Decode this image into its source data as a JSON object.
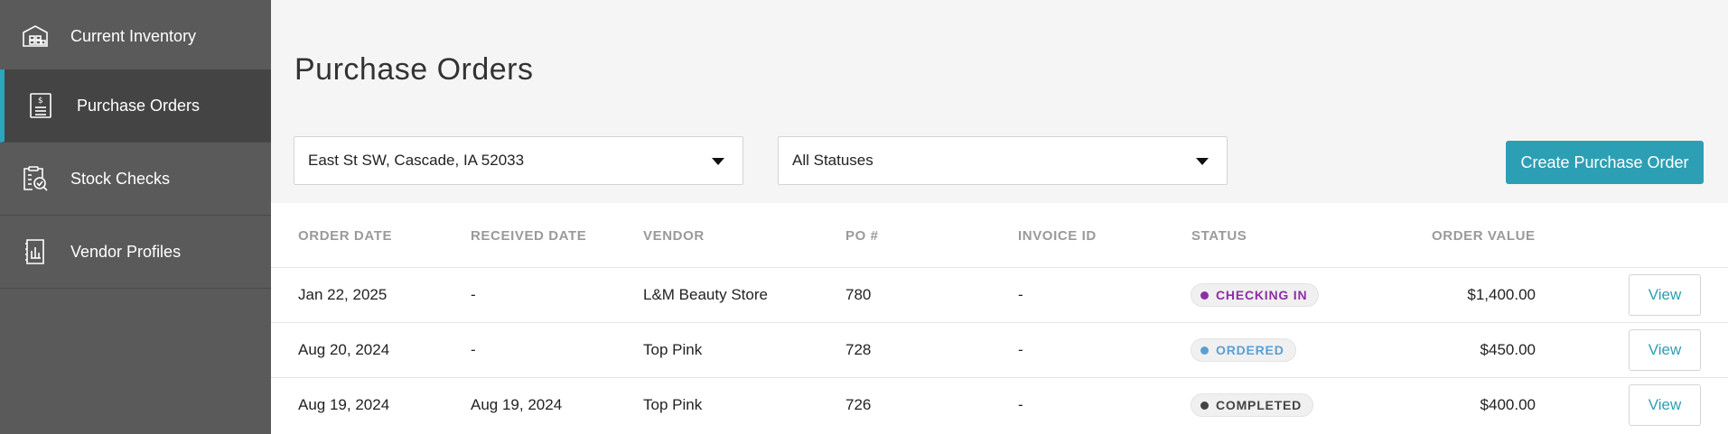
{
  "sidebar": {
    "items": [
      {
        "label": "Current Inventory",
        "icon": "warehouse-icon"
      },
      {
        "label": "Purchase Orders",
        "icon": "invoice-icon"
      },
      {
        "label": "Stock Checks",
        "icon": "clipboard-search-icon"
      },
      {
        "label": "Vendor Profiles",
        "icon": "vendor-document-icon"
      }
    ],
    "active_index": 1,
    "accent_color": "#2ba6bd"
  },
  "main": {
    "title": "Purchase Orders",
    "location_select": {
      "value": "East St SW, Cascade, IA 52033"
    },
    "status_select": {
      "value": "All Statuses"
    },
    "create_button": {
      "label": "Create Purchase Order",
      "color": "#2c9fb4"
    }
  },
  "table": {
    "headers": {
      "order_date": "ORDER DATE",
      "received_date": "RECEIVED DATE",
      "vendor": "VENDOR",
      "po": "PO #",
      "invoice_id": "INVOICE ID",
      "status": "STATUS",
      "order_value": "ORDER VALUE"
    },
    "rows": [
      {
        "order_date": "Jan 22, 2025",
        "received_date": "-",
        "vendor": "L&M Beauty Store",
        "po": "780",
        "invoice_id": "-",
        "status": "CHECKING IN",
        "status_color": "#8e2da8",
        "order_value": "$1,400.00",
        "action": "View"
      },
      {
        "order_date": "Aug 20, 2024",
        "received_date": "-",
        "vendor": "Top Pink",
        "po": "728",
        "invoice_id": "-",
        "status": "ORDERED",
        "status_color": "#5a9fd4",
        "order_value": "$450.00",
        "action": "View"
      },
      {
        "order_date": "Aug 19, 2024",
        "received_date": "Aug 19, 2024",
        "vendor": "Top Pink",
        "po": "726",
        "invoice_id": "-",
        "status": "COMPLETED",
        "status_color": "#444444",
        "order_value": "$400.00",
        "action": "View"
      }
    ]
  }
}
